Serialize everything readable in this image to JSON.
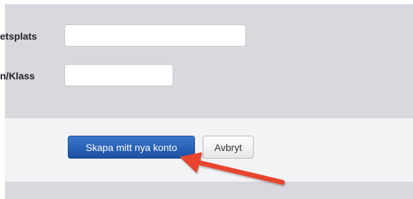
{
  "form": {
    "fields": [
      {
        "label": "etsplats",
        "value": ""
      },
      {
        "label": "n/Klass",
        "value": ""
      }
    ]
  },
  "actions": {
    "primary_label": "Skapa mitt nya konto",
    "secondary_label": "Avbryt"
  },
  "annotation": {
    "arrow_color": "#e8452e",
    "icon": "arrow-pointer-icon"
  },
  "colors": {
    "form_bg": "#d9d8de",
    "actions_bg": "#f3f3f5",
    "primary": "#2a62b8"
  }
}
